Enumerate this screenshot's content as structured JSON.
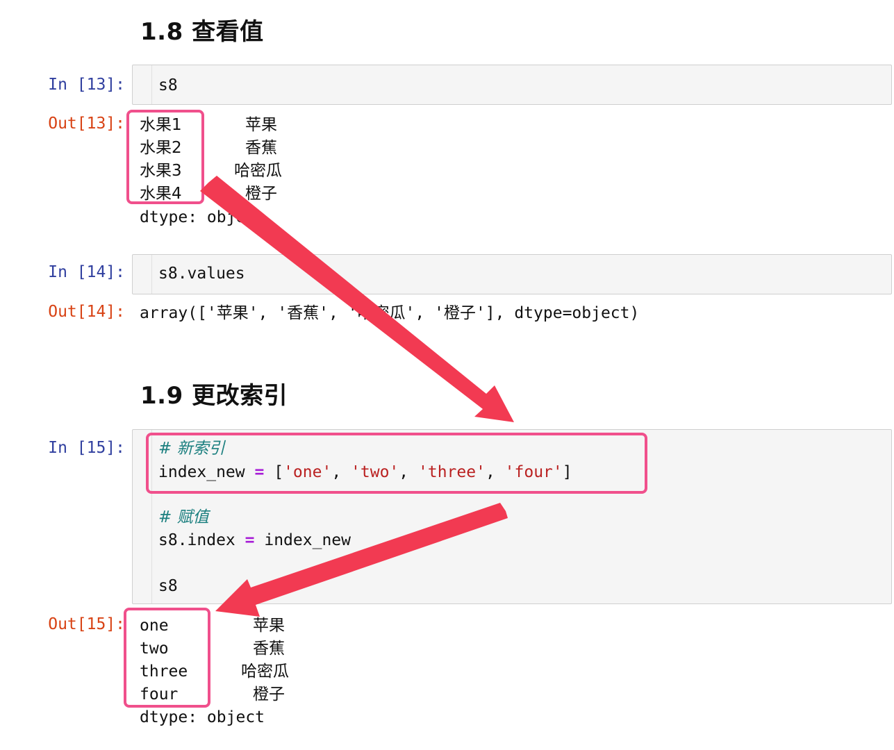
{
  "section_18": {
    "heading": "1.8  查看值"
  },
  "cell13": {
    "in_prompt": "In [13]:",
    "code": "s8",
    "out_prompt": "Out[13]:",
    "rows": [
      {
        "index": "水果1",
        "value": "苹果"
      },
      {
        "index": "水果2",
        "value": "香蕉"
      },
      {
        "index": "水果3",
        "value": "哈密瓜"
      },
      {
        "index": "水果4",
        "value": "橙子"
      }
    ],
    "dtype": "dtype: object"
  },
  "cell14": {
    "in_prompt": "In [14]:",
    "code": "s8.values",
    "out_prompt": "Out[14]:",
    "output": "array(['苹果', '香蕉', '哈密瓜', '橙子'], dtype=object)"
  },
  "section_19": {
    "heading": "1.9  更改索引"
  },
  "cell15": {
    "in_prompt": "In [15]:",
    "comment1": "# 新索引",
    "line2_var": "index_new",
    "line2_op": "=",
    "line2_open": "[",
    "str_one": "'one'",
    "str_two": "'two'",
    "str_three": "'three'",
    "str_four": "'four'",
    "line2_close": "]",
    "sep": ",",
    "comment2": "# 赋值",
    "line5_left": "s8.index",
    "line5_op": "=",
    "line5_right": "index_new",
    "line7": "s8",
    "out_prompt": "Out[15]:",
    "rows": [
      {
        "index": "one",
        "value": "苹果"
      },
      {
        "index": "two",
        "value": "香蕉"
      },
      {
        "index": "three",
        "value": "哈密瓜"
      },
      {
        "index": "four",
        "value": "橙子"
      }
    ],
    "dtype": "dtype: object"
  },
  "colors": {
    "highlight": "#f0508c",
    "arrow": "#f23a52",
    "in_prompt": "#303f9f",
    "out_prompt": "#d84315"
  }
}
